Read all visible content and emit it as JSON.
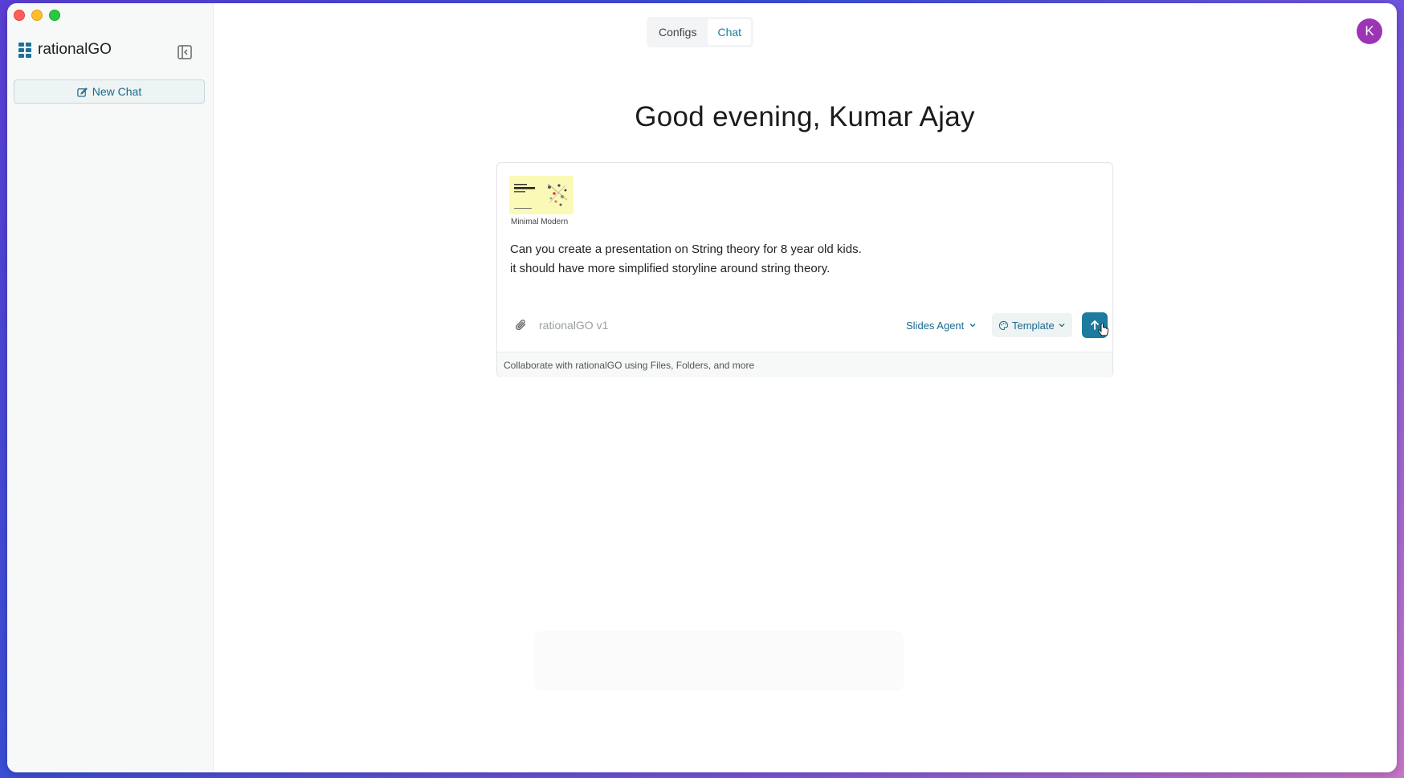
{
  "window": {
    "controls": [
      "close",
      "minimize",
      "zoom"
    ]
  },
  "sidebar": {
    "brand": "rationalGO",
    "logo_icon": "grid-logo-icon",
    "collapse_icon": "sidebar-collapse-icon",
    "new_chat_label": "New Chat",
    "new_chat_icon": "edit-icon"
  },
  "header": {
    "tabs": [
      {
        "label": "Configs",
        "active": false
      },
      {
        "label": "Chat",
        "active": true
      }
    ],
    "avatar_initial": "K"
  },
  "main": {
    "greeting": "Good evening, Kumar Ajay",
    "composer": {
      "template_preview_caption": "Minimal Modern",
      "prompt_lines": [
        "Can you create a presentation on String theory for 8 year old kids.",
        "it should have more simplified storyline around string theory."
      ],
      "model_label": "rationalGO v1",
      "agent_label": "Slides Agent",
      "template_label": "Template",
      "send_icon": "arrow-up-icon",
      "attach_icon": "paperclip-icon",
      "footer_text": "Collaborate with rationalGO using Files, Folders, and more"
    }
  },
  "colors": {
    "accent": "#1c7b9e",
    "avatar_bg": "#9b35b5",
    "thumb_bg": "#fbf9b6"
  }
}
